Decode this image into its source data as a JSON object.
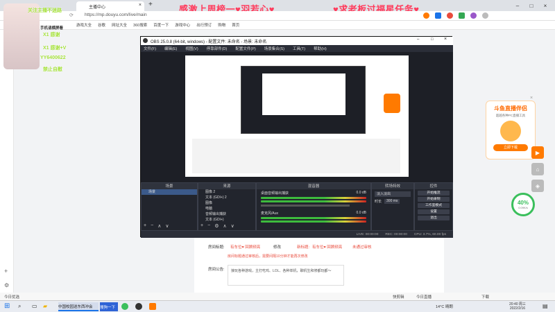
{
  "browser": {
    "tab_title": "主播中心",
    "url": "https://mp.douyu.com/live/main",
    "bookmarks": [
      "游戏大全",
      "谷歌",
      "网址大全",
      "360搜索",
      "百度一下",
      "游戏中心",
      "出行预订",
      "购物",
      "首页"
    ],
    "banner_left": "感激上周榜一♥羽若心♥",
    "banner_right": "♥求老板过福星任务♥"
  },
  "overlay": {
    "line1": "关注主播不迷路",
    "line2": "手机请横屏看",
    "line3": "X1 感谢",
    "line4": "X1 感谢+V",
    "line5": "YY6400622",
    "line6": "禁止自慰"
  },
  "obs": {
    "title": "OBS 25.0.8 (64-bit, windows) - 配置文件: 未命名 - 场景: 未命名",
    "menu": [
      "文件(F)",
      "编辑(E)",
      "视图(V)",
      "停靠部件(D)",
      "配置文件(P)",
      "场景集合(S)",
      "工具(T)",
      "帮助(H)"
    ],
    "docks": {
      "scenes": "场景",
      "sources": "来源",
      "mixer": "混音器",
      "transitions": "转场特效",
      "controls": "控件"
    },
    "scene_item": "场景",
    "sources": [
      "图像 2",
      "文本 (GDI+) 2",
      "图像",
      "电脑",
      "音频输出捕获",
      "文本 (GDI+)"
    ],
    "mixer": [
      {
        "name": "桌面音频输出捕获",
        "db": "0.0 dB"
      },
      {
        "name": "麦克风/Aux",
        "db": "0.0 dB"
      }
    ],
    "transition": {
      "fade": "淡入淡出",
      "duration_label": "时长",
      "duration": "300 ms"
    },
    "controls": [
      "开始推流",
      "开始录制",
      "工作室模式",
      "设置",
      "退出"
    ],
    "status": {
      "live": "LIVE: 00:00:00",
      "rec": "REC: 00:00:00",
      "cpu": "CPU: 3.7%, 60.00 fps"
    }
  },
  "page": {
    "room_title_label": "房间标题:",
    "room_title_value": "有车位♥ 回顾频亮",
    "edit_label": "修改",
    "new_title_label": "新标题:",
    "new_title_value": "有车位♥ 回顾频亮",
    "review_status": "未通过审核",
    "notice": "房间标题通过审核后，需要间隔10分钟才能再次修改",
    "announce_label": "房间公告:",
    "announce_text": "接玩各种游戏，主打吃鸡、LOL、各种单机，聊机生和修都玩都～"
  },
  "right": {
    "rank_title": "斗鱼直播伴侣",
    "rank_sub": "超越各种PC直播工具",
    "rank_button": "立即下载",
    "progress_percent": "40%",
    "progress_speed": "0.09K/s"
  },
  "statusbar": {
    "left": "今日优选",
    "right1": "快剪辑",
    "right2": "今日直播",
    "right3": "下载"
  },
  "taskbar": {
    "items": [
      "中国校园送东西冲会",
      "搜狗一下"
    ],
    "weather": "14°C 晴朗",
    "time": "20:40 周三",
    "date": "2022/2/16"
  }
}
